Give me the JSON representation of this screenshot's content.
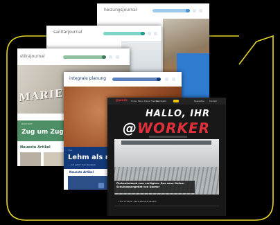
{
  "colors": {
    "outline": "#e8d92a",
    "background": "#000000",
    "heiz_accent": "#6fb2e6",
    "san_accent": "#2fb5a4",
    "stil_accent": "#4f8f67",
    "int_accent": "#123a7a",
    "worker_accent": "#e0303a"
  },
  "cards": {
    "heizungsjournal": {
      "title": "heizungsjournal"
    },
    "sanitaerjournal": {
      "title": "sanitärjournal"
    },
    "stilrajournal": {
      "title": "stilrajournal",
      "sign_text": "MARIENSCH",
      "teaser_kicker": "BAUSTOFF",
      "teaser_title": "Zug um Zug",
      "section_label": "Neueste Artikel"
    },
    "integrale_planung": {
      "title": "integrale planung",
      "teaser_kicker": "TGA",
      "teaser_title": "Lehm als na",
      "teaser_sub": "... mit Lehm\" den Bauwerk",
      "section_label": "Neueste Artikel"
    },
    "worker": {
      "logo": "@work",
      "nav_items": [
        "Home",
        "Menu",
        "Praxis Themen",
        "Marktplatz"
      ],
      "nav_right": [
        "Newsletter",
        "Kontakt"
      ],
      "headline_1": "HALLO, IHR",
      "headline_2_at": "@",
      "headline_2_rest": "WORKER",
      "caption": "Fächenheizend zum verfügten: Das neue Online-Schulungsangebot von Uponor",
      "footer_label": "FÜR KÜNDE ANHFENGEWINNEN"
    }
  }
}
